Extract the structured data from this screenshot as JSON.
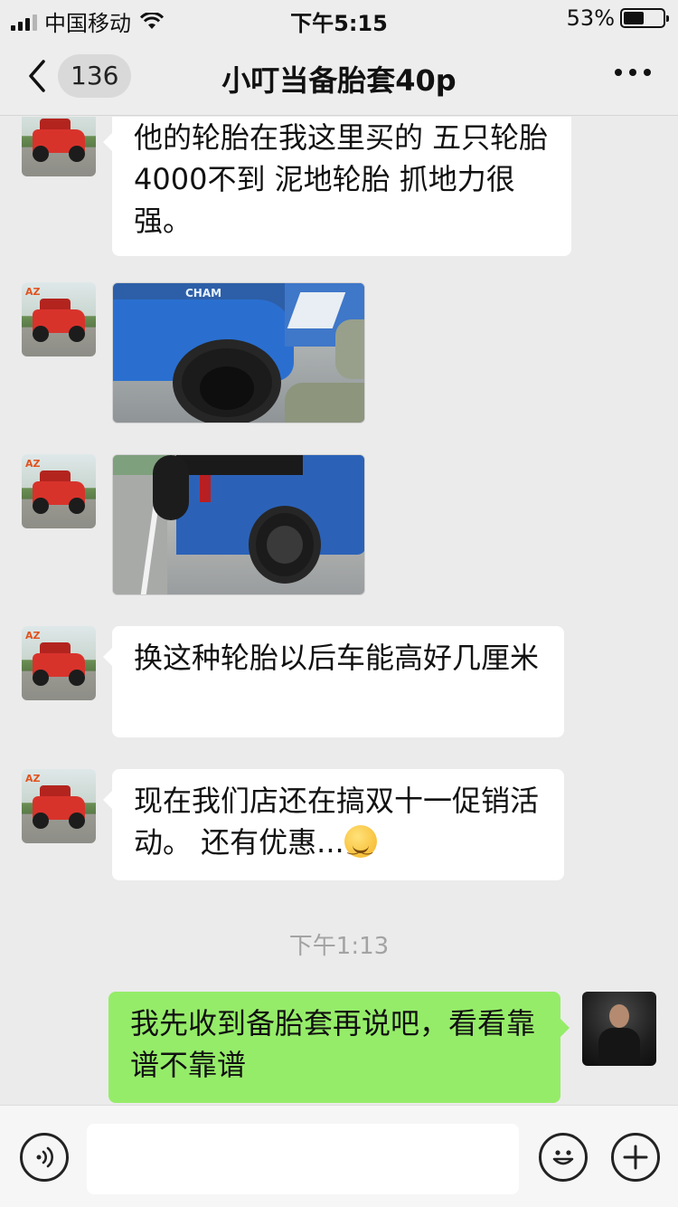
{
  "status_bar": {
    "carrier": "中国移动",
    "time": "下午5:15",
    "battery": "53%",
    "battery_level": 0.53
  },
  "nav": {
    "back_count": "136",
    "title": "小叮当备胎套40p",
    "more_icon": "more-dots-icon"
  },
  "messages": {
    "m1": {
      "text": "他的轮胎在我这里买的 五只轮胎4000不到  泥地轮胎 抓地力很强。"
    },
    "m4": {
      "text": "换这种轮胎以后车能高好几厘米"
    },
    "m5": {
      "text": "现在我们店还在搞双十一促销活动。 还有优惠..."
    },
    "timestamp": "下午1:13",
    "m6": {
      "text": "我先收到备胎套再说吧，看看靠谱不靠谱"
    }
  },
  "photo1": {
    "label": "CHAM"
  },
  "input_bar": {
    "voice_icon": "voice-icon",
    "emoji_icon": "emoji-icon",
    "plus_icon": "plus-icon"
  },
  "colors": {
    "bubble_self": "#95ec69",
    "bubble_other": "#ffffff",
    "background": "#ebebeb"
  }
}
